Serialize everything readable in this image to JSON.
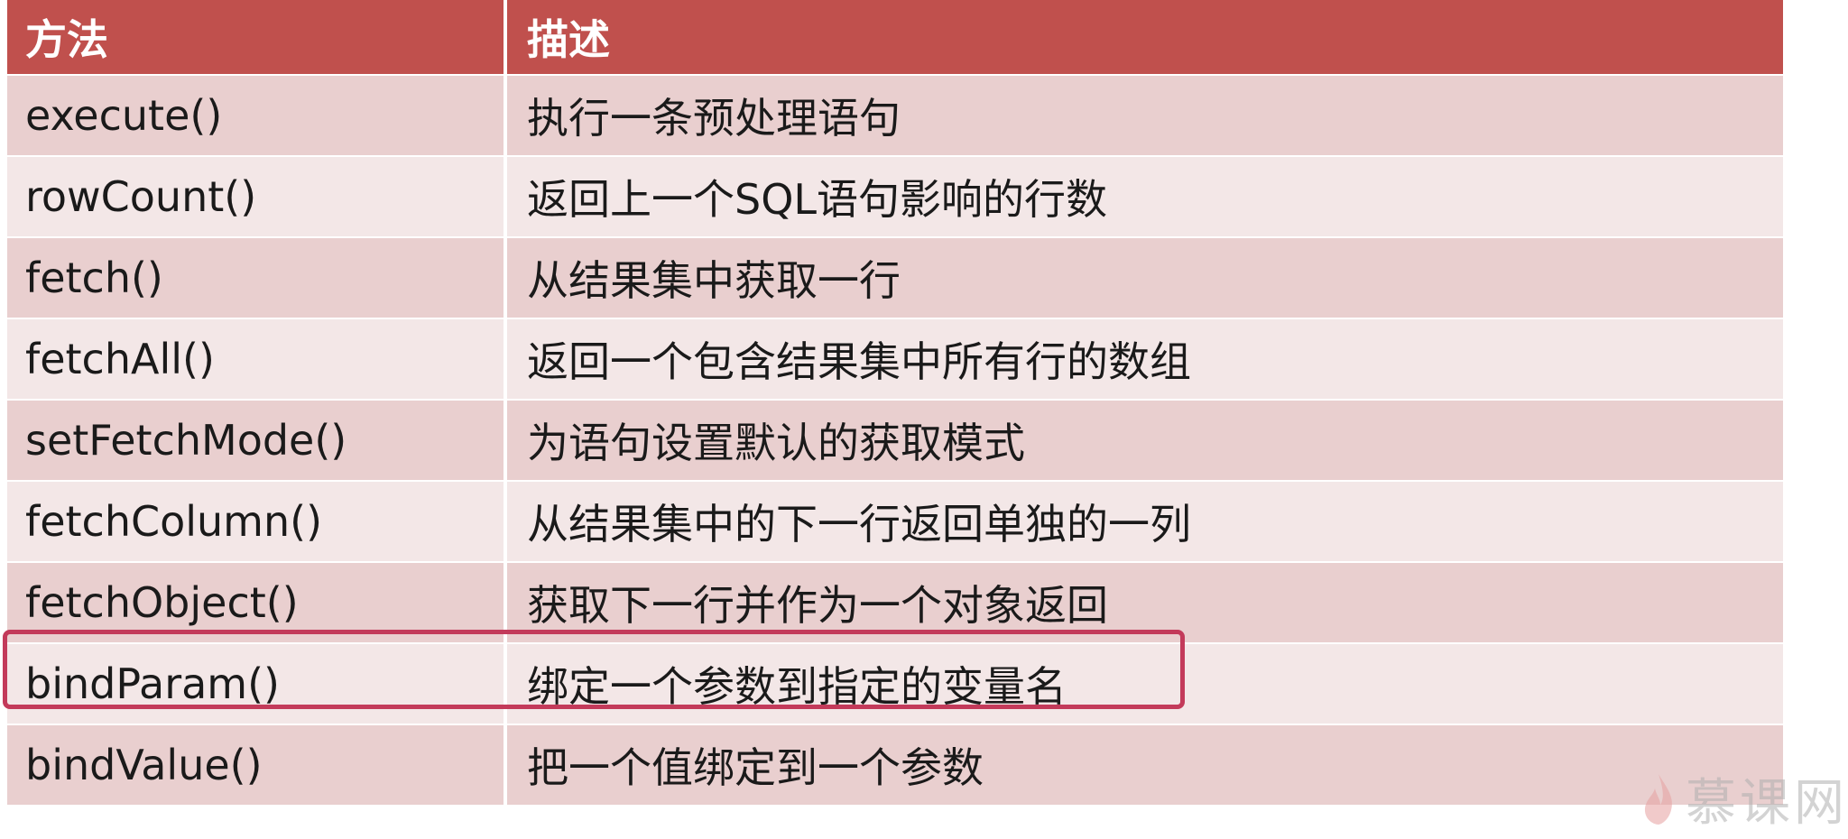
{
  "table": {
    "headers": [
      "方法",
      "描述"
    ],
    "rows": [
      {
        "method": "execute()",
        "description": "执行一条预处理语句"
      },
      {
        "method": "rowCount()",
        "description": "返回上一个SQL语句影响的行数"
      },
      {
        "method": "fetch()",
        "description": "从结果集中获取一行"
      },
      {
        "method": "fetchAll()",
        "description": "返回一个包含结果集中所有行的数组"
      },
      {
        "method": "setFetchMode()",
        "description": "为语句设置默认的获取模式"
      },
      {
        "method": "fetchColumn()",
        "description": "从结果集中的下一行返回单独的一列"
      },
      {
        "method": "fetchObject()",
        "description": "获取下一行并作为一个对象返回"
      },
      {
        "method": "bindParam()",
        "description": "绑定一个参数到指定的变量名"
      },
      {
        "method": "bindValue()",
        "description": "把一个值绑定到一个参数"
      }
    ],
    "highlighted_row": 7
  },
  "colors": {
    "header_bg": "#c0504d",
    "row_odd_bg": "#e9cfcf",
    "row_even_bg": "#f3e7e7",
    "highlight_border": "#c33a5a"
  },
  "watermark": {
    "logo_icon": "flame-logo-icon",
    "text": "慕课网"
  }
}
